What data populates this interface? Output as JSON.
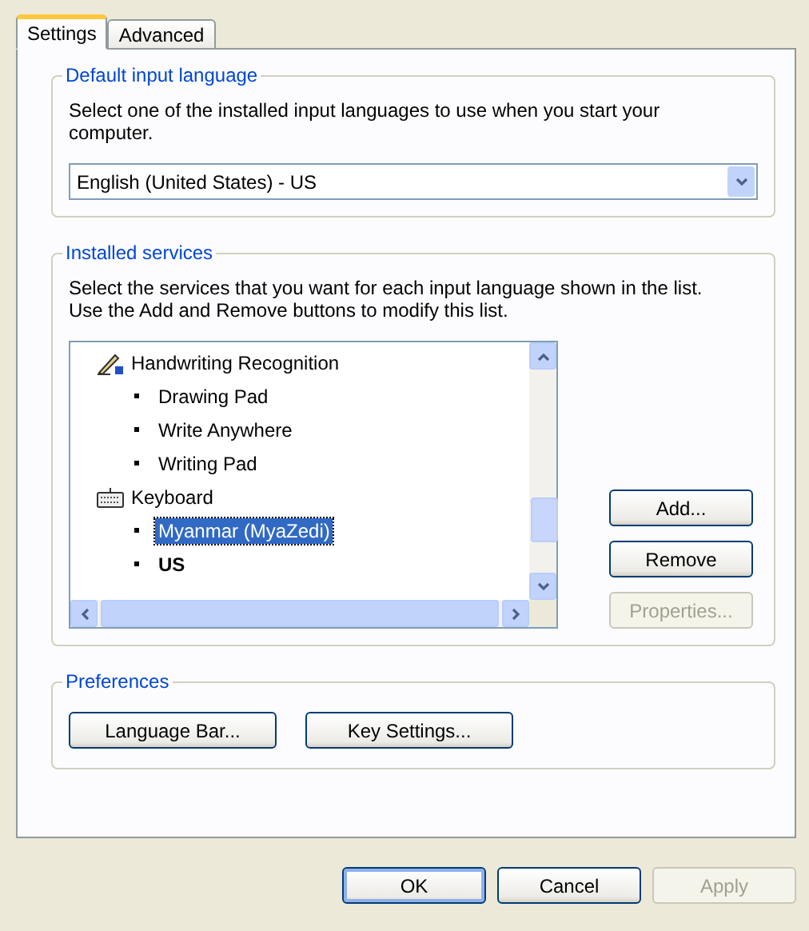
{
  "tabs": [
    {
      "label": "Settings",
      "selected": true
    },
    {
      "label": "Advanced",
      "selected": false
    }
  ],
  "default_input_language": {
    "title": "Default input language",
    "description": "Select one of the installed input languages to use when you start your computer.",
    "value": "English (United States) - US"
  },
  "installed_services": {
    "title": "Installed services",
    "description": "Select the services that you want for each input language shown in the list. Use the Add and Remove buttons to modify this list.",
    "tree": [
      {
        "label": "Handwriting Recognition",
        "kind": "pen",
        "children": [
          {
            "label": "Drawing Pad",
            "selected": false,
            "default": false
          },
          {
            "label": "Write Anywhere",
            "selected": false,
            "default": false
          },
          {
            "label": "Writing Pad",
            "selected": false,
            "default": false
          }
        ]
      },
      {
        "label": "Keyboard",
        "kind": "keyboard",
        "children": [
          {
            "label": "Myanmar (MyaZedi)",
            "selected": true,
            "default": false
          },
          {
            "label": "US",
            "selected": false,
            "default": true
          }
        ]
      }
    ],
    "buttons": [
      {
        "label": "Add...",
        "disabled": false
      },
      {
        "label": "Remove",
        "disabled": false
      },
      {
        "label": "Properties...",
        "disabled": true
      }
    ]
  },
  "preferences": {
    "title": "Preferences",
    "buttons": [
      {
        "label": "Language Bar...",
        "disabled": false
      },
      {
        "label": "Key Settings...",
        "disabled": false
      }
    ]
  },
  "dialog_buttons": [
    {
      "label": "OK",
      "disabled": false,
      "default": true
    },
    {
      "label": "Cancel",
      "disabled": false,
      "default": false
    },
    {
      "label": "Apply",
      "disabled": true,
      "default": false
    }
  ]
}
